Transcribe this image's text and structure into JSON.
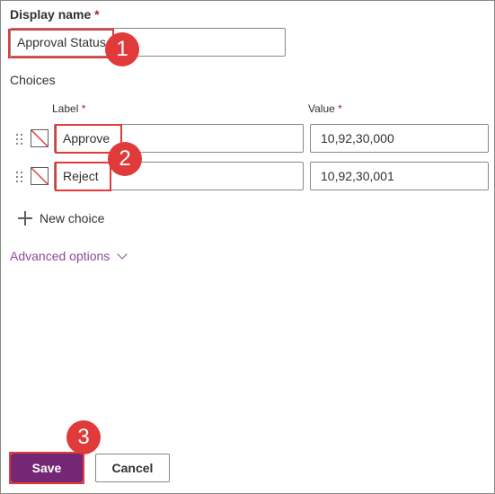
{
  "form": {
    "display_name_label": "Display name",
    "required_marker": "*",
    "display_name_value": "Approval Status",
    "choices_heading": "Choices",
    "label_column": "Label",
    "value_column": "Value",
    "choices": [
      {
        "label": "Approve",
        "value": "10,92,30,000"
      },
      {
        "label": "Reject",
        "value": "10,92,30,001"
      }
    ],
    "new_choice": "New choice",
    "advanced_options": "Advanced options"
  },
  "footer": {
    "save_label": "Save",
    "cancel_label": "Cancel"
  },
  "annotations": {
    "step1": "1",
    "step2": "2",
    "step3": "3",
    "color": "#e03a3a"
  },
  "colors": {
    "accent": "#742774",
    "link": "#8a4a9a",
    "required": "#a4262c"
  },
  "icons": {
    "drag": "drag-handle-icon",
    "color_swatch": "no-color-swatch-icon",
    "add": "plus-icon",
    "expand": "chevron-down-icon"
  }
}
